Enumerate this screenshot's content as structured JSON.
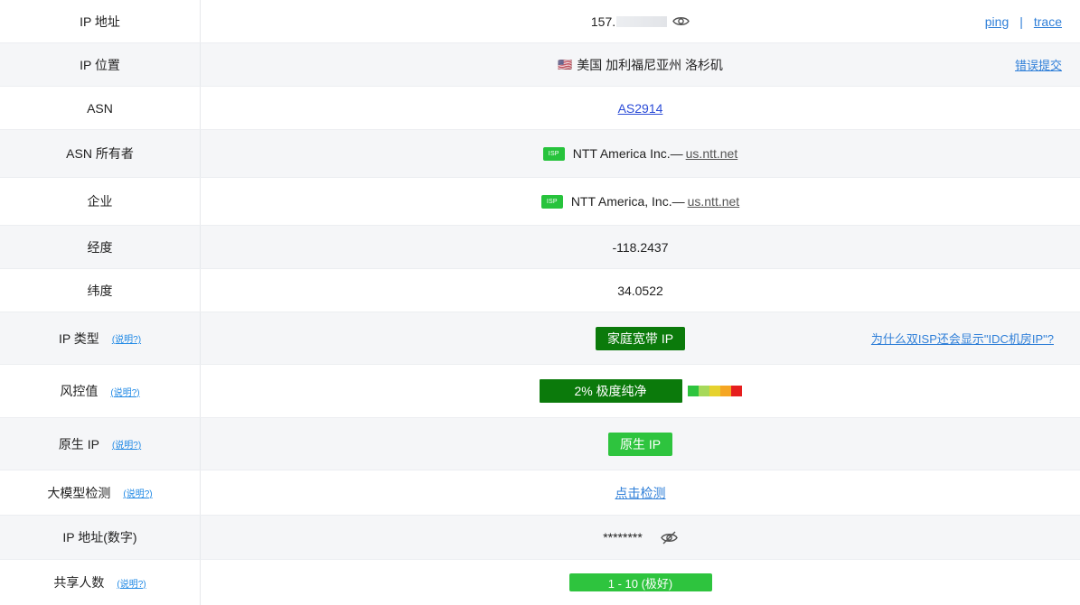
{
  "rows": {
    "ip": {
      "label": "IP 地址",
      "value_prefix": "157.",
      "links": {
        "ping": "ping",
        "separator": "|",
        "trace": "trace"
      }
    },
    "location": {
      "label": "IP 位置",
      "flag": "🇺🇸",
      "value": "美国 加利福尼亚州 洛杉矶",
      "report": "错误提交"
    },
    "asn": {
      "label": "ASN",
      "value": "AS2914"
    },
    "asn_owner": {
      "label": "ASN 所有者",
      "badge": "ISP",
      "name": "NTT America Inc.—",
      "domain": "us.ntt.net"
    },
    "company": {
      "label": "企业",
      "badge": "ISP",
      "name": "NTT America, Inc.—",
      "domain": "us.ntt.net"
    },
    "longitude": {
      "label": "经度",
      "value": "-118.2437"
    },
    "latitude": {
      "label": "纬度",
      "value": "34.0522"
    },
    "ip_type": {
      "label": "IP 类型",
      "hint": "(说明?)",
      "value": "家庭宽带 IP",
      "faq": "为什么双ISP还会显示\"IDC机房IP\"?"
    },
    "risk": {
      "label": "风控值",
      "hint": "(说明?)",
      "value": "2%  极度纯净",
      "scale_colors": [
        "#2ec43e",
        "#a6d95a",
        "#e6d22e",
        "#f5a623",
        "#e61e1e"
      ]
    },
    "native": {
      "label": "原生 IP",
      "hint": "(说明?)",
      "value": "原生 IP"
    },
    "llm": {
      "label": "大模型检测",
      "hint": "(说明?)",
      "value": "点击检测"
    },
    "ip_numeric": {
      "label": "IP 地址(数字)",
      "value": "********"
    },
    "shared": {
      "label": "共享人数",
      "hint": "(说明?)",
      "value": "1 - 10 (极好)"
    }
  },
  "colors": {
    "dark_green": "#0b7a0b",
    "light_green": "#2ec43e",
    "link_blue": "#2f7fd8"
  }
}
